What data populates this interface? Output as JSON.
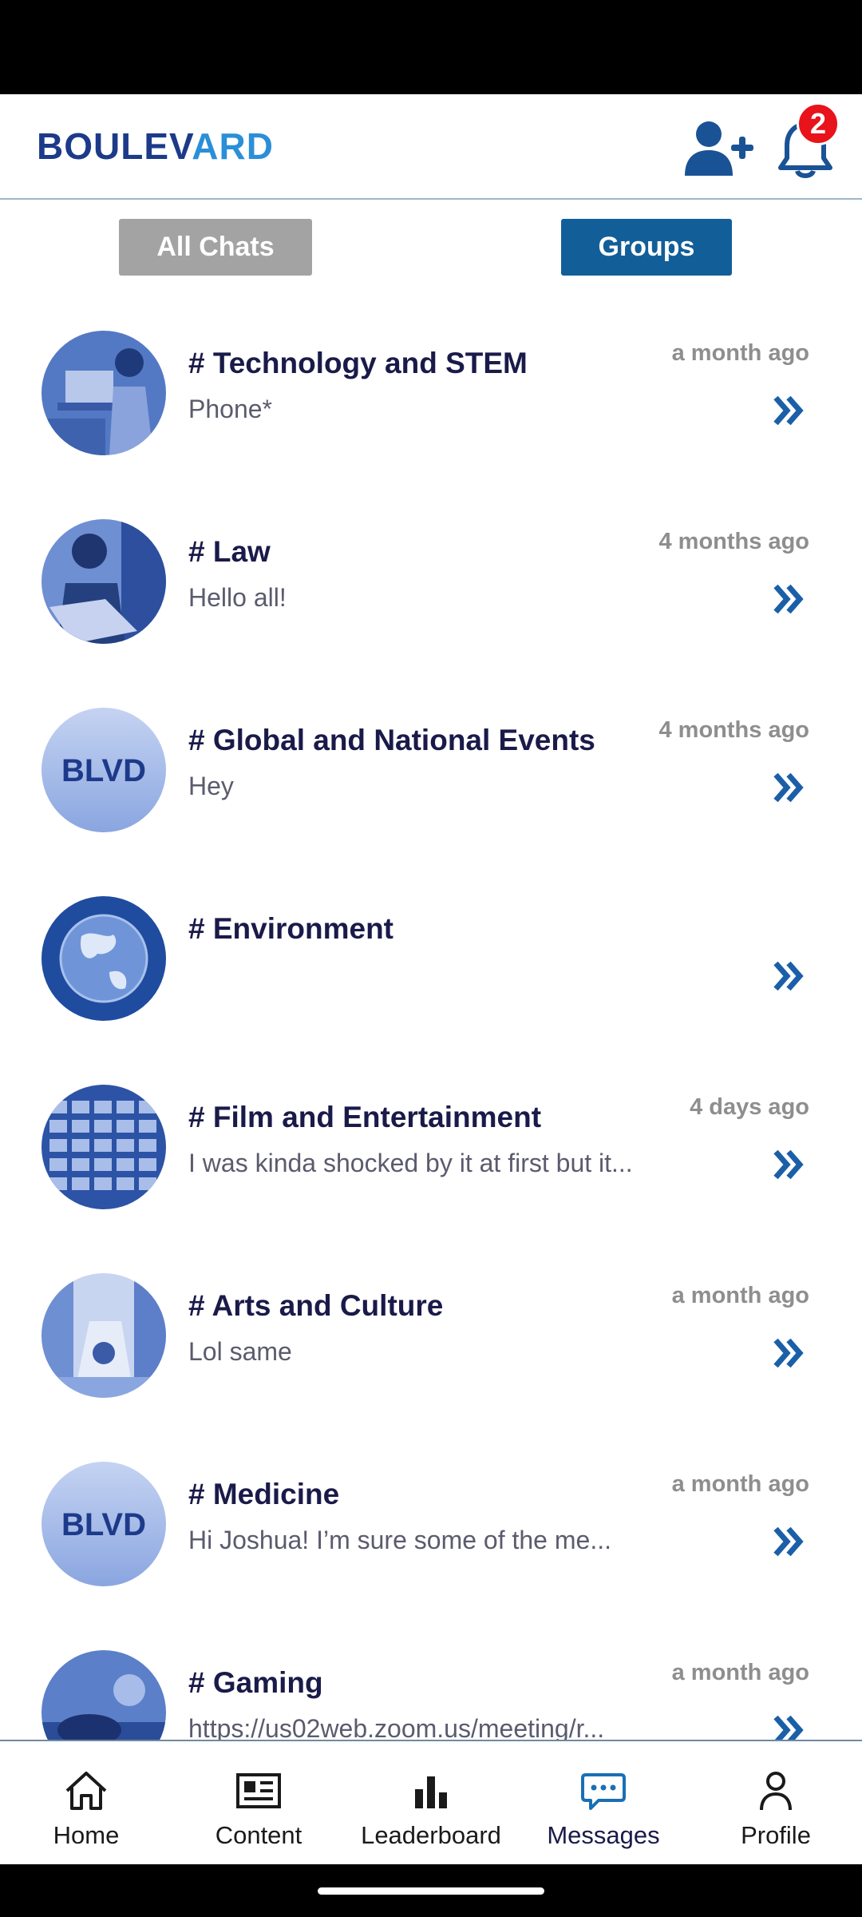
{
  "header": {
    "logo_a": "BOULEV",
    "logo_b": "ARD",
    "notification_count": "2"
  },
  "filters": {
    "all_chats": "All Chats",
    "groups": "Groups",
    "selected": "Groups"
  },
  "groups": [
    {
      "title": "# Technology and STEM",
      "preview": "Phone*",
      "time": "a month ago",
      "avatar": "photo"
    },
    {
      "title": "# Law",
      "preview": "Hello all!",
      "time": "4 months ago",
      "avatar": "photo"
    },
    {
      "title": "# Global and National Events",
      "preview": "Hey",
      "time": "4 months ago",
      "avatar": "blvd-logo",
      "avatar_text": "BLVD"
    },
    {
      "title": "# Environment",
      "preview": "",
      "time": "",
      "avatar": "earth"
    },
    {
      "title": "# Film and Entertainment",
      "preview": "I was kinda shocked by it at first but it...",
      "time": "4 days ago",
      "avatar": "photo"
    },
    {
      "title": "# Arts and Culture",
      "preview": "Lol same",
      "time": "a month ago",
      "avatar": "photo"
    },
    {
      "title": "# Medicine",
      "preview": "Hi Joshua! I’m sure some of the me...",
      "time": "a month ago",
      "avatar": "blvd-logo",
      "avatar_text": "BLVD"
    },
    {
      "title": "# Gaming",
      "preview": "https://us02web.zoom.us/meeting/r...",
      "time": "a month ago",
      "avatar": "photo"
    }
  ],
  "bottom_nav": [
    {
      "label": "Home",
      "icon": "home-icon"
    },
    {
      "label": "Content",
      "icon": "newspaper-icon"
    },
    {
      "label": "Leaderboard",
      "icon": "bar-chart-icon"
    },
    {
      "label": "Messages",
      "icon": "chat-bubble-icon",
      "active": true
    },
    {
      "label": "Profile",
      "icon": "person-icon"
    }
  ],
  "colors": {
    "brand_dark": "#1d3a8a",
    "brand_light": "#2b8fd8",
    "groups_button": "#125e99",
    "all_chats_button": "#a3a3a3",
    "badge": "#e8131b",
    "chevron": "#1a5fa8"
  }
}
